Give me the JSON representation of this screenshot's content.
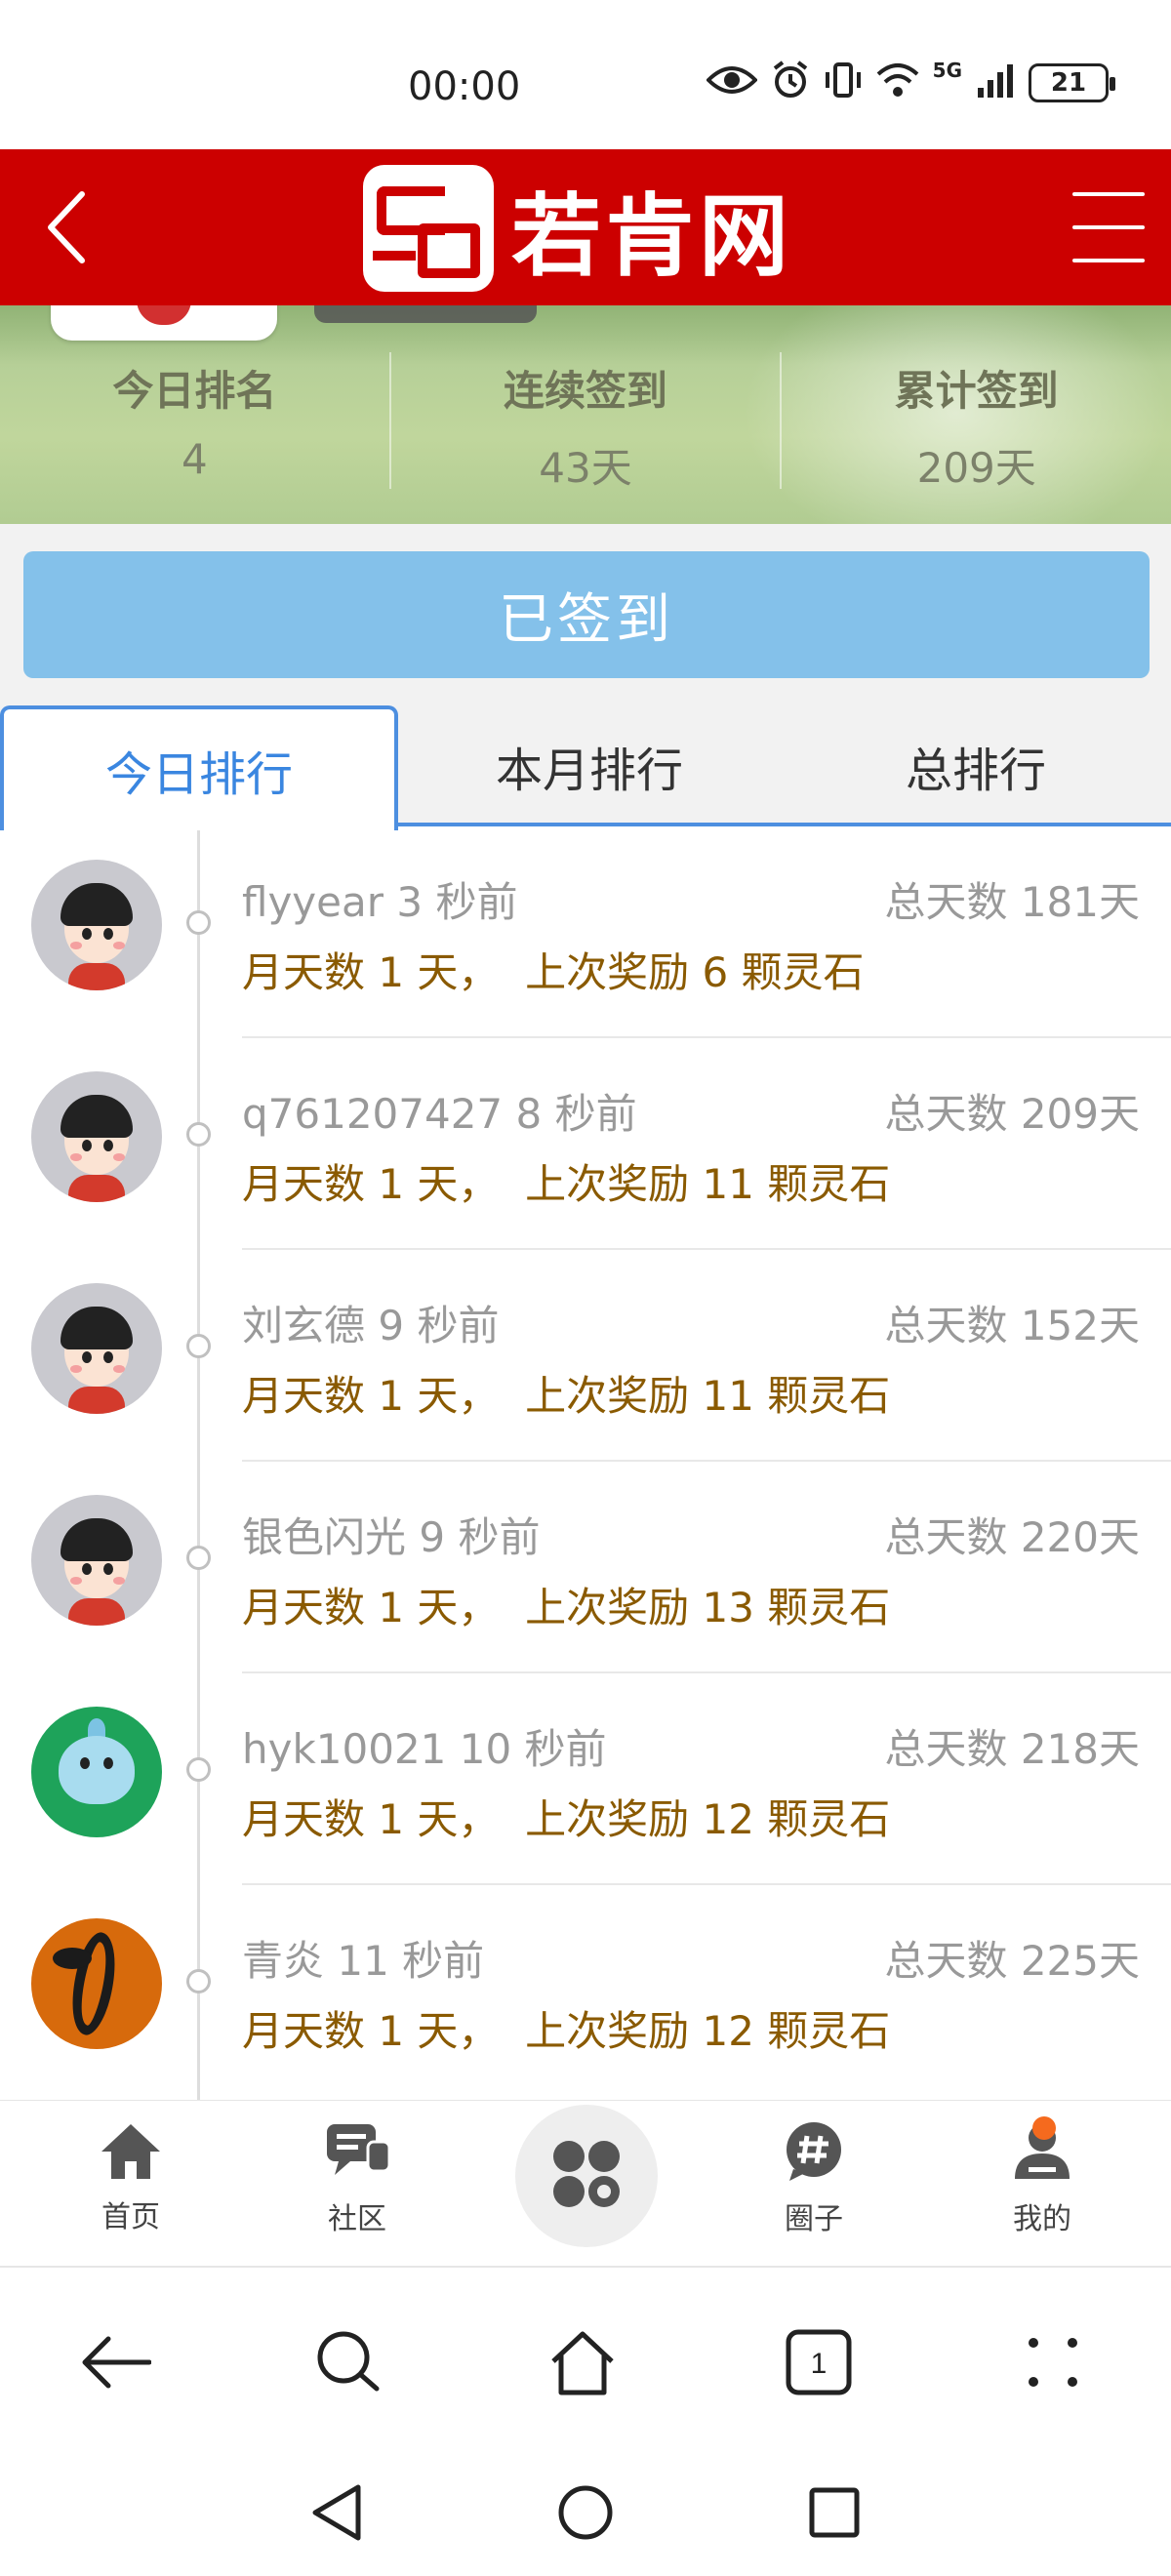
{
  "status_bar": {
    "time": "00:00",
    "network_label": "5G",
    "battery": "21",
    "icons": [
      "eye-icon",
      "alarm-icon",
      "vibrate-icon",
      "wifi-icon",
      "signal-icon",
      "battery-icon"
    ]
  },
  "header": {
    "site_name": "若肯网",
    "icons": [
      "back-arrow-icon",
      "hamburger-menu-icon"
    ],
    "bg_color": "#cc0000"
  },
  "stats": [
    {
      "label": "今日排名",
      "value": "4"
    },
    {
      "label": "连续签到",
      "value": "43天"
    },
    {
      "label": "累计签到",
      "value": "209天"
    }
  ],
  "sign_button": {
    "label": "已签到",
    "color": "#84c1ea"
  },
  "tabs": [
    {
      "label": "今日排行",
      "active": true
    },
    {
      "label": "本月排行",
      "active": false
    },
    {
      "label": "总排行",
      "active": false
    }
  ],
  "list": [
    {
      "user": "flyyear",
      "time": "3 秒前",
      "total": "总天数 181天",
      "detail": "月天数 1 天，  上次奖励 6 颗灵石",
      "avatar": "boy"
    },
    {
      "user": "q761207427",
      "time": "8 秒前",
      "total": "总天数 209天",
      "detail": "月天数 1 天，  上次奖励 11 颗灵石",
      "avatar": "boy"
    },
    {
      "user": "刘玄德",
      "time": "9 秒前",
      "total": "总天数 152天",
      "detail": "月天数 1 天，  上次奖励 11 颗灵石",
      "avatar": "boy"
    },
    {
      "user": "银色闪光",
      "time": "9 秒前",
      "total": "总天数 220天",
      "detail": "月天数 1 天，  上次奖励 13 颗灵石",
      "avatar": "boy"
    },
    {
      "user": "hyk10021",
      "time": "10 秒前",
      "total": "总天数 218天",
      "detail": "月天数 1 天，  上次奖励 12 颗灵石",
      "avatar": "green"
    },
    {
      "user": "青炎",
      "time": "11 秒前",
      "total": "总天数 225天",
      "detail": "月天数 1 天，  上次奖励 12 颗灵石",
      "avatar": "dragon"
    }
  ],
  "app_nav": [
    {
      "label": "首页",
      "icon": "home-icon"
    },
    {
      "label": "社区",
      "icon": "chat-icon"
    },
    {
      "label": "",
      "icon": "apps-grid-icon"
    },
    {
      "label": "圈子",
      "icon": "hashtag-icon"
    },
    {
      "label": "我的",
      "icon": "profile-icon",
      "badge": true
    }
  ],
  "browser_bar": {
    "tab_count": "1",
    "icons": [
      "back-icon",
      "search-icon",
      "home-icon",
      "tabs-icon",
      "more-icon"
    ]
  },
  "system_nav": {
    "icons": [
      "nav-back-icon",
      "nav-home-icon",
      "nav-recents-icon"
    ]
  }
}
